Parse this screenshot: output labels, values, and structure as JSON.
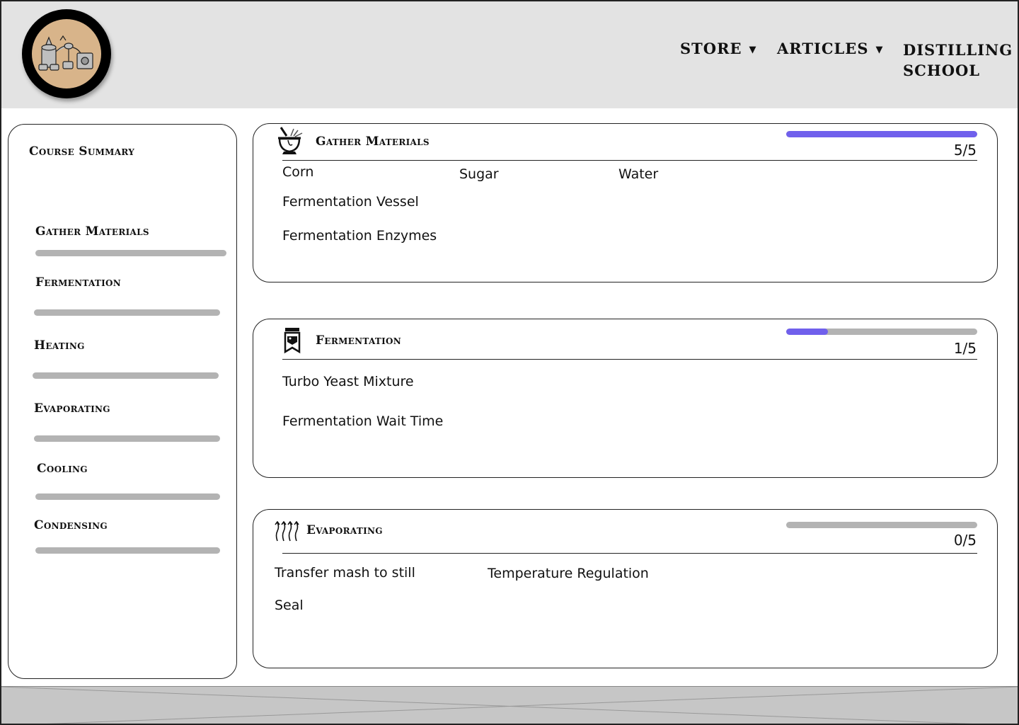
{
  "nav": {
    "store": "STORE",
    "articles": "ARTICLES",
    "school_line1": "DISTILLING",
    "school_line2": "SCHOOL",
    "caret": "▼"
  },
  "sidebar": {
    "title": "Course Summary",
    "items": [
      {
        "label": "Gather Materials"
      },
      {
        "label": "Fermentation"
      },
      {
        "label": "Heating"
      },
      {
        "label": "Evaporating"
      },
      {
        "label": "Cooling"
      },
      {
        "label": "Condensing"
      }
    ]
  },
  "cards": [
    {
      "title": "Gather Materials",
      "icon": "mortar-pestle-icon",
      "progress_text": "5/5",
      "progress_fraction": 1.0,
      "tasks": [
        "Corn",
        "Sugar",
        "Water",
        "Fermentation Vessel",
        "Fermentation Enzymes"
      ]
    },
    {
      "title": "Fermentation",
      "icon": "fermentation-jar-icon",
      "progress_text": "1/5",
      "progress_fraction": 0.22,
      "tasks": [
        "Turbo Yeast Mixture",
        "Fermentation Wait Time"
      ]
    },
    {
      "title": "Evaporating",
      "icon": "evaporation-arrows-icon",
      "progress_text": "0/5",
      "progress_fraction": 0.0,
      "tasks": [
        "Transfer mash to still",
        "Temperature Regulation",
        "Seal"
      ]
    }
  ],
  "colors": {
    "accent": "#7060ec",
    "track": "#b3b3b3",
    "header_bg": "#e3e3e3",
    "logo_bg": "#d8b48a"
  }
}
